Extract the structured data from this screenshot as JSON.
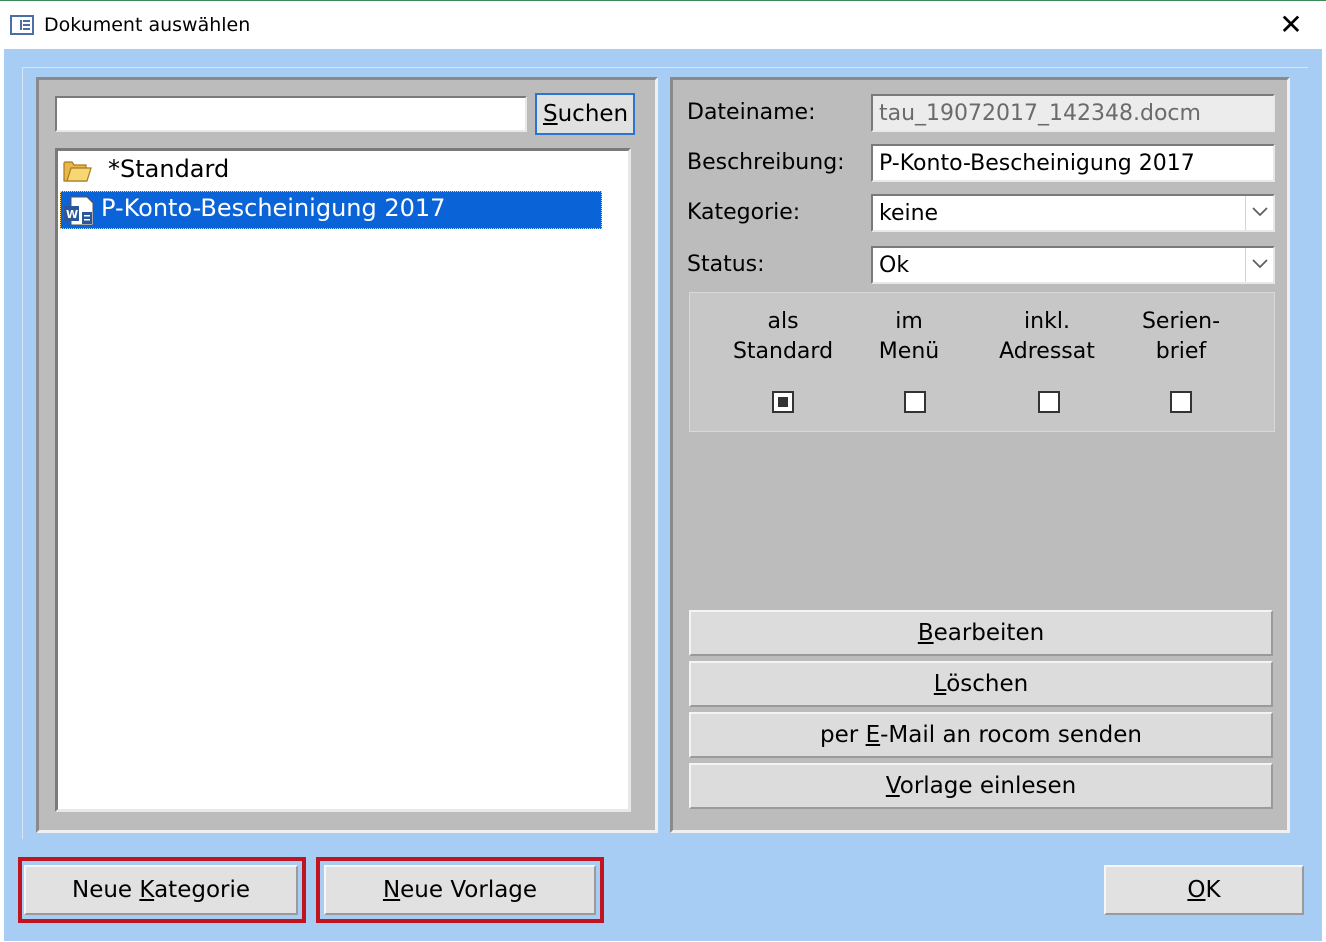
{
  "window": {
    "title": "Dokument auswählen",
    "close_glyph": "✕"
  },
  "search": {
    "value": "",
    "button_label": "Suchen",
    "button_mnemonic": "S",
    "button_rest": "uchen"
  },
  "tree": {
    "items": [
      {
        "label": "*Standard",
        "icon": "folder-icon",
        "selected": false
      },
      {
        "label": "P-Konto-Bescheinigung 2017",
        "icon": "word-document-icon",
        "selected": true
      }
    ]
  },
  "details": {
    "dateiname_label": "Dateiname:",
    "dateiname_value": "tau_19072017_142348.docm",
    "beschreibung_label": "Beschreibung:",
    "beschreibung_value": "P-Konto-Bescheinigung 2017",
    "kategorie_label": "Kategorie:",
    "kategorie_value": "keine",
    "status_label": "Status:",
    "status_value": "Ok"
  },
  "options": {
    "als_standard": {
      "line1": "als",
      "line2": "Standard",
      "checked": true
    },
    "im_menu": {
      "line1": "im",
      "line2": "Menü",
      "checked": false
    },
    "inkl_adressat": {
      "line1": "inkl.",
      "line2": "Adressat",
      "checked": false
    },
    "serienbrief": {
      "line1": "Serien-",
      "line2": "brief",
      "checked": false
    }
  },
  "actions": {
    "bearbeiten": {
      "mnemonic": "B",
      "rest": "earbeiten"
    },
    "loeschen": {
      "mnemonic": "L",
      "rest": "öschen"
    },
    "email": {
      "pre": "per ",
      "mnemonic": "E",
      "rest": "-Mail an rocom senden"
    },
    "vorlage_einlesen": {
      "mnemonic": "V",
      "rest": "orlage einlesen"
    }
  },
  "bottom": {
    "neue_kategorie": {
      "pre": "Neue ",
      "mnemonic": "K",
      "rest": "ategorie"
    },
    "neue_vorlage": {
      "mnemonic": "N",
      "rest": "eue Vorlage"
    },
    "ok": {
      "mnemonic": "O",
      "rest": "K"
    }
  },
  "colors": {
    "client_bg": "#a7cdf5",
    "panel_bg": "#bcbcbc",
    "selection": "#0a64d8",
    "highlight_box": "#c0141e"
  }
}
